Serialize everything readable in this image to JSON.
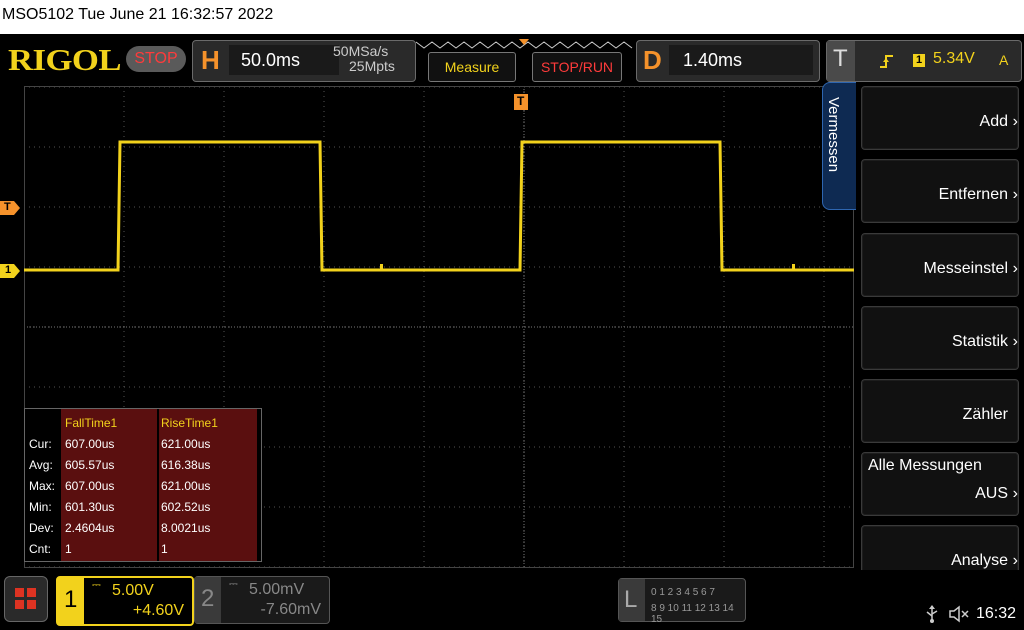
{
  "title_bar": {
    "text": "MSO5102  Tue June 21 16:32:57 2022"
  },
  "header": {
    "logo": "RIGOL",
    "run_state": "STOP",
    "horizontal": {
      "label": "H",
      "timebase": "50.0ms",
      "sample_rate": "50MSa/s",
      "memory_depth": "25Mpts"
    },
    "measure_button": "Measure",
    "stop_run_button": "STOP/RUN",
    "delay": {
      "label": "D",
      "value": "1.40ms"
    },
    "trigger": {
      "label": "T",
      "channel": "1",
      "level": "5.34V",
      "mode": "A"
    }
  },
  "markers": {
    "trigger_top": "T",
    "trigger_level_left": "T",
    "channel1_ground": "1"
  },
  "side_menu": {
    "tab_title": "Vermessen",
    "items": [
      {
        "label": "Add"
      },
      {
        "label": "Entfernen"
      },
      {
        "label": "Messeinstel"
      },
      {
        "label": "Statistik"
      },
      {
        "label": "Zähler"
      },
      {
        "top_label": "Alle Messungen",
        "label": "AUS"
      },
      {
        "label": "Analyse"
      }
    ]
  },
  "measurements": {
    "columns": [
      "FallTime1",
      "RiseTime1"
    ],
    "rows": [
      {
        "label": "Cur:",
        "values": [
          "607.00us",
          "621.00us"
        ]
      },
      {
        "label": "Avg:",
        "values": [
          "605.57us",
          "616.38us"
        ]
      },
      {
        "label": "Max:",
        "values": [
          "607.00us",
          "621.00us"
        ]
      },
      {
        "label": "Min:",
        "values": [
          "601.30us",
          "602.52us"
        ]
      },
      {
        "label": "Dev:",
        "values": [
          "2.4604us",
          "8.0021us"
        ]
      },
      {
        "label": "Cnt:",
        "values": [
          "1",
          "1"
        ]
      }
    ]
  },
  "channels": [
    {
      "number": "1",
      "scale": "5.00V",
      "offset": "+4.60V",
      "active": true
    },
    {
      "number": "2",
      "scale": "5.00mV",
      "offset": "-7.60mV",
      "active": false
    }
  ],
  "logic": {
    "label": "L",
    "row1": "0 1 2 3   4 5 6 7",
    "row2": "8 9 10 11 12 13 14 15"
  },
  "status": {
    "time": "16:32",
    "usb_icon": "usb-icon",
    "sound_icon": "speaker-muted-icon"
  },
  "colors": {
    "channel1": "#f2d21c",
    "accent": "#f5922b",
    "stop": "#ff3b3b",
    "menu_tab": "#0e2a52"
  }
}
